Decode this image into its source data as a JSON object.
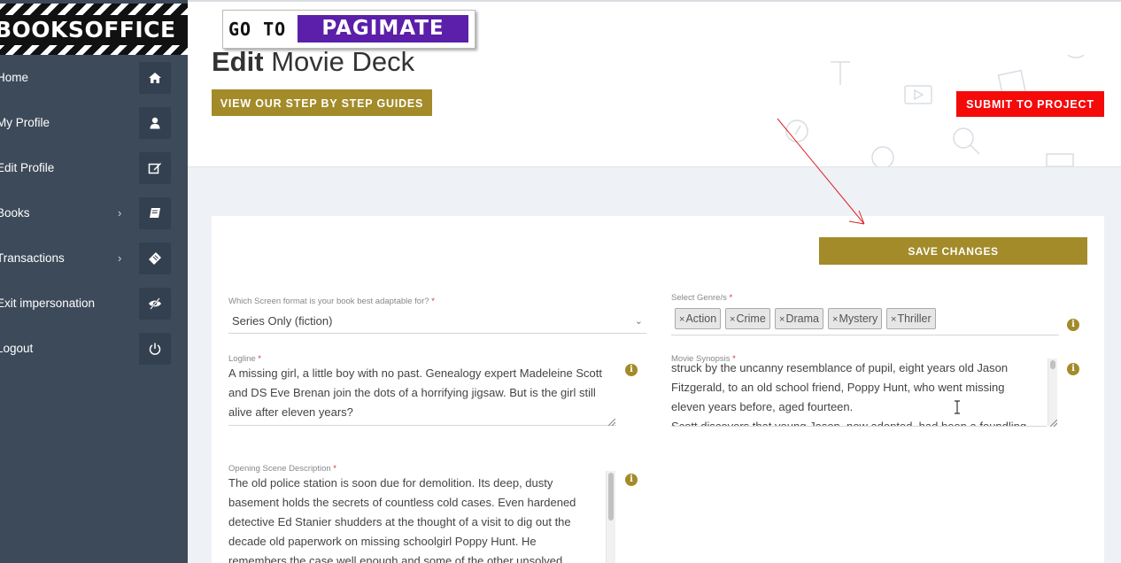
{
  "brand": {
    "logo_text": "BOOKSOFFICE"
  },
  "header": {
    "goto_text": "GO TO >",
    "pagimate_text": "PAGIMATE",
    "title_bold": "Edit",
    "title_rest": "Movie Deck",
    "guides_button": "VIEW OUR STEP BY STEP GUIDES",
    "submit_button": "SUBMIT TO PROJECT"
  },
  "sidebar": {
    "items": [
      {
        "label": "Home",
        "icon": "home-icon",
        "has_submenu": false
      },
      {
        "label": "My Profile",
        "icon": "user-icon",
        "has_submenu": false
      },
      {
        "label": "Edit Profile",
        "icon": "edit-icon",
        "has_submenu": false
      },
      {
        "label": "Books",
        "icon": "book-icon",
        "has_submenu": true
      },
      {
        "label": "Transactions",
        "icon": "ticket-icon",
        "has_submenu": true
      },
      {
        "label": "Exit impersonation",
        "icon": "eye-slash-icon",
        "has_submenu": false
      },
      {
        "label": "Logout",
        "icon": "power-icon",
        "has_submenu": false
      }
    ],
    "chevron": "›"
  },
  "form": {
    "save_button": "SAVE CHANGES",
    "required_mark": "*",
    "screen_format": {
      "label": "Which Screen format is your book best adaptable for?",
      "value": "Series Only (fiction)"
    },
    "genres": {
      "label": "Select Genre/s",
      "tags": [
        "Action",
        "Crime",
        "Drama",
        "Mystery",
        "Thriller"
      ],
      "remove_glyph": "×"
    },
    "logline": {
      "label": "Logline",
      "value": "A missing girl, a little boy with no past. Genealogy expert Madeleine Scott and DS Eve Brenan join the dots of a horrifying jigsaw. But is the girl still alive after eleven years?"
    },
    "synopsis": {
      "label": "Movie Synopsis",
      "lines": [
        "struck by the uncanny resemblance of pupil, eight years old Jason",
        "Fitzgerald, to an old school friend, Poppy Hunt, who went missing",
        "eleven years before, aged fourteen.",
        "Scott discovers that young Jason, now adopted, had been a foundling"
      ]
    },
    "opening_scene": {
      "label": "Opening Scene Description",
      "value": "The old police station is soon due for demolition. Its deep, dusty basement holds the secrets of countless cold cases. Even hardened detective Ed Stanier shudders at the thought of a visit to dig out the decade old paperwork on missing schoolgirl Poppy Hunt. He remembers the case well enough and some of the other unsolved"
    },
    "info_glyph": "i"
  },
  "colors": {
    "sidebar": "#3d4a5a",
    "gold": "#a38b2a",
    "red": "#f50a0a",
    "purple": "#5b1faa",
    "annotation": "#e02020"
  }
}
